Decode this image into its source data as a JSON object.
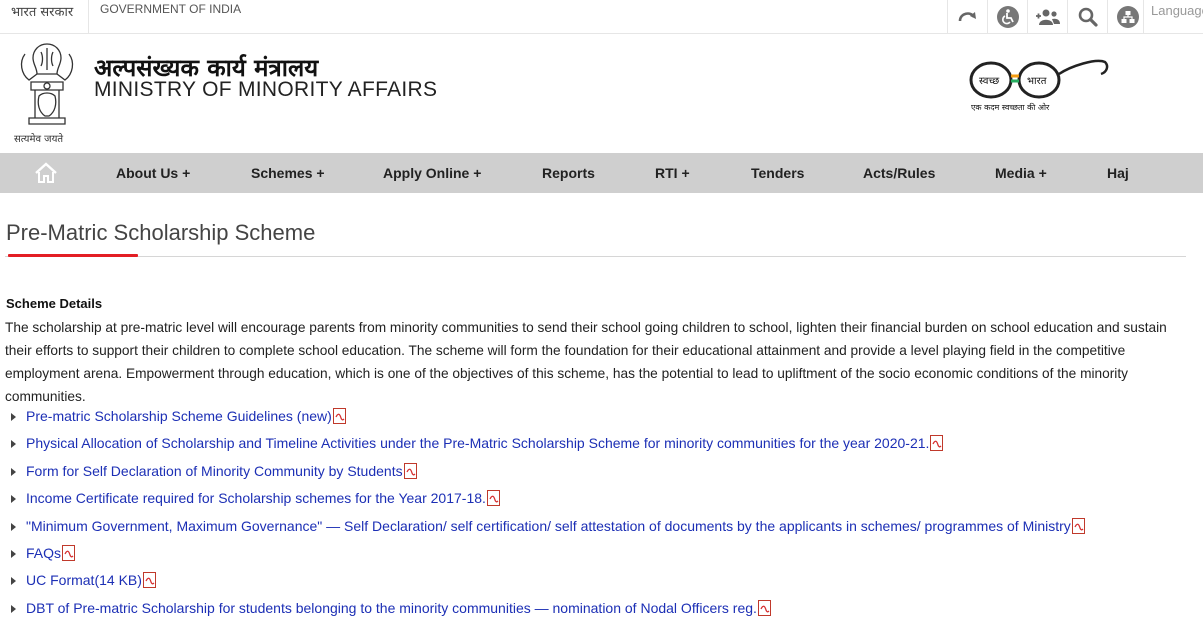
{
  "topbar": {
    "hindi_label": "भारत सरकार",
    "gov_label": "GOVERNMENT OF INDIA",
    "icons": [
      "skip-to-content-icon",
      "accessibility-icon",
      "sitemap-users-icon",
      "search-icon",
      "share-icon"
    ],
    "language_label": "Language"
  },
  "header": {
    "ministry_hindi": "अल्पसंख्यक कार्य मंत्रालय",
    "ministry_english": "MINISTRY OF MINORITY AFFAIRS",
    "emblem_caption": "सत्यमेव जयते",
    "swachh_left": "स्वच्छ",
    "swachh_right": "भारत",
    "swachh_tagline": "एक कदम स्वच्छता की ओर"
  },
  "nav": {
    "home_icon": "home-icon",
    "items": [
      {
        "label": "About Us +"
      },
      {
        "label": "Schemes +"
      },
      {
        "label": "Apply Online +"
      },
      {
        "label": "Reports"
      },
      {
        "label": "RTI +"
      },
      {
        "label": "Tenders"
      },
      {
        "label": "Acts/Rules"
      },
      {
        "label": "Media +"
      },
      {
        "label": "Haj"
      }
    ]
  },
  "page": {
    "title": "Pre-Matric Scholarship Scheme",
    "section_heading": "Scheme Details",
    "description": "The scholarship at pre-matric level will encourage parents from minority communities to send their school going children to school, lighten their financial burden on school education and sustain their efforts to support their children to complete school education. The scheme will form the foundation for their educational attainment and provide a level playing field in the competitive employment arena. Empowerment through education, which is one of the objectives of this scheme, has the potential to lead to upliftment of the socio economic conditions of the minority communities.",
    "links": [
      {
        "label": "Pre-matric Scholarship Scheme Guidelines (new)"
      },
      {
        "label": "Physical Allocation of Scholarship and Timeline Activities under the Pre-Matric Scholarship Scheme for minority communities for the year 2020-21."
      },
      {
        "label": "Form for Self Declaration of Minority Community by Students"
      },
      {
        "label": "Income Certificate required for Scholarship schemes for the Year 2017-18."
      },
      {
        "label": "\"Minimum Government, Maximum Governance\" — Self Declaration/ self certification/ self attestation of documents by the applicants in schemes/ programmes of Ministry"
      },
      {
        "label": "FAQs"
      },
      {
        "label": "UC Format(14 KB)"
      },
      {
        "label": "DBT of Pre-matric Scholarship for students belonging to the minority communities — nomination of Nodal Officers reg."
      }
    ],
    "link_icon": "pdf-icon"
  },
  "colors": {
    "nav_background": "#cfcfcf",
    "link": "#1c2fb5",
    "title_accent": "#e31e24"
  }
}
